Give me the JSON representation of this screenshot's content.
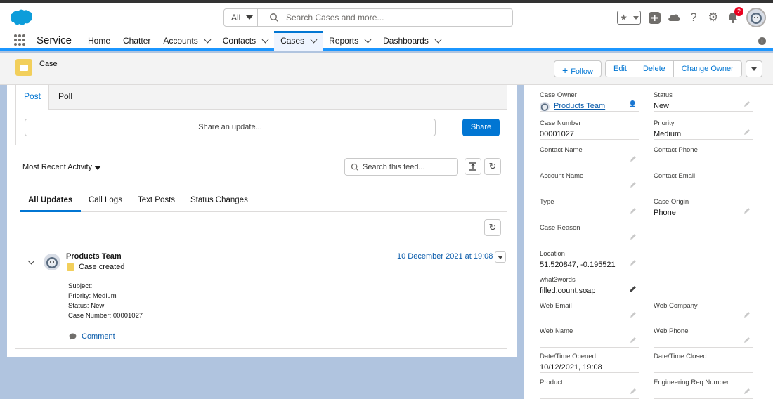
{
  "global_header": {
    "search": {
      "scope": "All",
      "placeholder": "Search Cases and more..."
    },
    "notifications_count": "2"
  },
  "nav": {
    "app_name": "Service",
    "items": [
      {
        "label": "Home",
        "has_menu": false
      },
      {
        "label": "Chatter",
        "has_menu": false
      },
      {
        "label": "Accounts",
        "has_menu": true
      },
      {
        "label": "Contacts",
        "has_menu": true
      },
      {
        "label": "Cases",
        "has_menu": true,
        "active": true
      },
      {
        "label": "Reports",
        "has_menu": true
      },
      {
        "label": "Dashboards",
        "has_menu": true
      }
    ]
  },
  "record_header": {
    "object_label": "Case",
    "actions": {
      "follow": "Follow",
      "edit": "Edit",
      "delete": "Delete",
      "change_owner": "Change Owner"
    }
  },
  "publisher": {
    "tabs": [
      "Post",
      "Poll"
    ],
    "placeholder": "Share an update...",
    "share_label": "Share"
  },
  "feed": {
    "sort_label": "Most Recent Activity",
    "search_placeholder": "Search this feed...",
    "tabs": [
      "All Updates",
      "Call Logs",
      "Text Posts",
      "Status Changes"
    ],
    "post": {
      "author": "Products Team",
      "action": "Case created",
      "date": "10 December 2021 at 19:08",
      "lines": [
        "Subject:",
        "Priority: Medium",
        "Status: New",
        "Case Number: 00001027"
      ],
      "comment_label": "Comment"
    }
  },
  "details": {
    "case_owner": {
      "label": "Case Owner",
      "value": "Products Team"
    },
    "status": {
      "label": "Status",
      "value": "New"
    },
    "case_number": {
      "label": "Case Number",
      "value": "00001027"
    },
    "priority": {
      "label": "Priority",
      "value": "Medium"
    },
    "contact_name": {
      "label": "Contact Name",
      "value": ""
    },
    "contact_phone": {
      "label": "Contact Phone",
      "value": ""
    },
    "account_name": {
      "label": "Account Name",
      "value": ""
    },
    "contact_email": {
      "label": "Contact Email",
      "value": ""
    },
    "type": {
      "label": "Type",
      "value": ""
    },
    "case_origin": {
      "label": "Case Origin",
      "value": "Phone"
    },
    "case_reason": {
      "label": "Case Reason",
      "value": ""
    },
    "location": {
      "label": "Location",
      "value": "51.520847, -0.195521"
    },
    "what3words": {
      "label": "what3words",
      "value": "filled.count.soap"
    },
    "web_email": {
      "label": "Web Email",
      "value": ""
    },
    "web_company": {
      "label": "Web Company",
      "value": ""
    },
    "web_name": {
      "label": "Web Name",
      "value": ""
    },
    "web_phone": {
      "label": "Web Phone",
      "value": ""
    },
    "date_opened": {
      "label": "Date/Time Opened",
      "value": "10/12/2021, 19:08"
    },
    "date_closed": {
      "label": "Date/Time Closed",
      "value": ""
    },
    "product": {
      "label": "Product",
      "value": ""
    },
    "engineering_req": {
      "label": "Engineering Req Number",
      "value": ""
    }
  },
  "colors": {
    "brand": "#0176d3",
    "link": "#0b5cab",
    "case_icon": "#f2cf5b",
    "badge": "#ea001e",
    "background": "#b0c4df"
  }
}
